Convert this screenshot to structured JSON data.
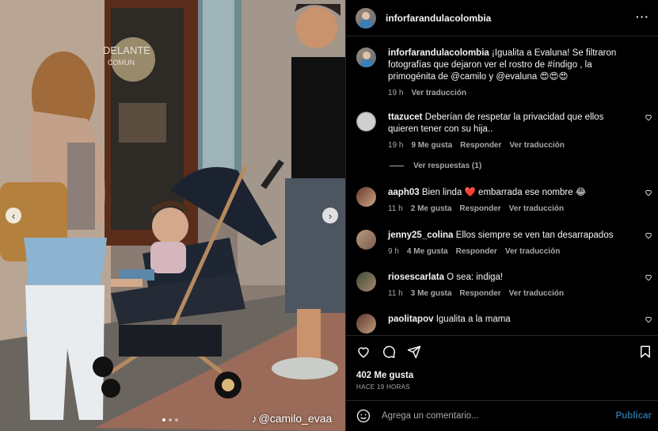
{
  "photo": {
    "store_sign_line1": "DELANTE",
    "store_sign_line2": "COMUN",
    "watermark": "@camilo_evaa",
    "slide_count": 3,
    "active_slide": 1
  },
  "header": {
    "username": "inforfarandulacolombia",
    "more": "···"
  },
  "caption": {
    "username": "inforfarandulacolombia",
    "text": "¡Igualita a Evaluna! Se filtraron fotografías que dejaron ver el rostro de #índigo , la primogénita de @camilo y @evaluna 😍😍😍",
    "time": "19 h",
    "translate": "Ver traducción"
  },
  "comments": [
    {
      "username": "ttazucet",
      "text": "Deberían de respetar la privacidad que ellos quieren tener con su hija..",
      "time": "19 h",
      "likes": "9 Me gusta",
      "reply": "Responder",
      "translate": "Ver traducción",
      "replies": "Ver respuestas (1)"
    },
    {
      "username": "aaph03",
      "text": "Bien linda ❤️ embarrada ese nombre 😂",
      "time": "11 h",
      "likes": "2 Me gusta",
      "reply": "Responder",
      "translate": "Ver traducción"
    },
    {
      "username": "jenny25_colina",
      "text": "Ellos siempre se ven tan desarrapados",
      "time": "9 h",
      "likes": "4 Me gusta",
      "reply": "Responder",
      "translate": "Ver traducción"
    },
    {
      "username": "riosescarlata",
      "text": "O sea: indiga!",
      "time": "11 h",
      "likes": "3 Me gusta",
      "reply": "Responder",
      "translate": "Ver traducción"
    },
    {
      "username": "paolitapov",
      "text": "Igualita a la mama",
      "time": "",
      "likes": "",
      "reply": "",
      "translate": ""
    }
  ],
  "footer": {
    "likes": "402 Me gusta",
    "time_ago": "HACE 19 HORAS",
    "comment_placeholder": "Agrega un comentario...",
    "publish": "Publicar"
  },
  "colors": {
    "background": "#000000",
    "text": "#f5f5f5",
    "secondary": "#a8a8a8",
    "divider": "#262626",
    "publish_disabled": "#2a6b9a"
  },
  "icons": [
    "more-icon",
    "heart-icon",
    "comment-icon",
    "share-icon",
    "bookmark-icon",
    "emoji-icon",
    "chevron-left-icon",
    "chevron-right-icon"
  ]
}
